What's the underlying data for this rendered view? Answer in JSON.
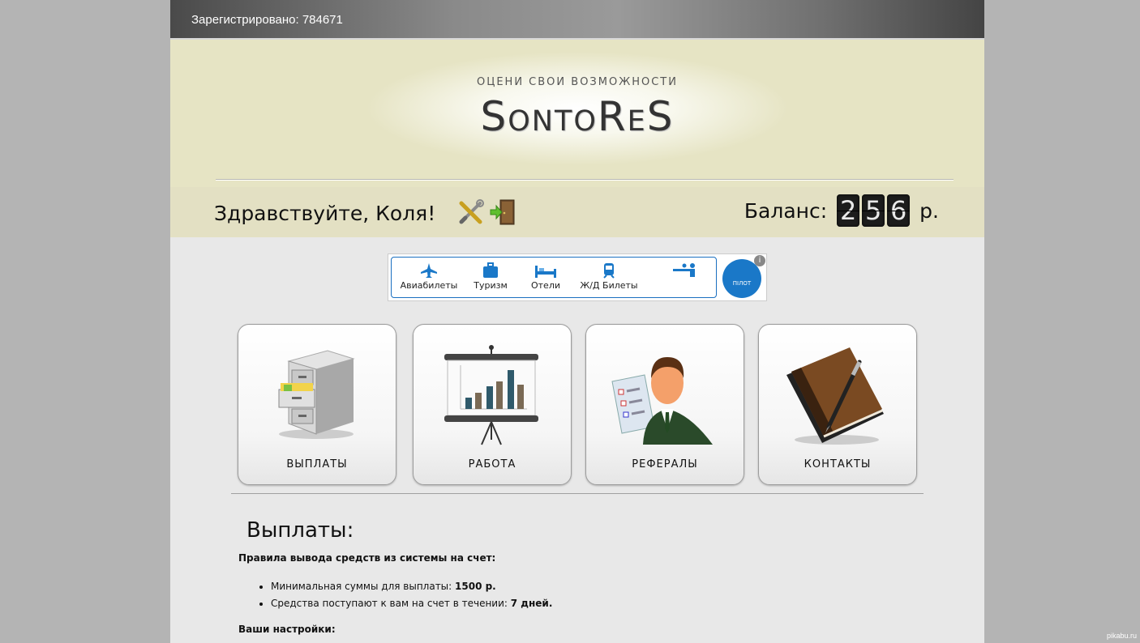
{
  "topbar": {
    "registered": "Зарегистрировано: 784671"
  },
  "header": {
    "slogan": "ОЦЕНИ СВОИ ВОЗМОЖНОСТИ",
    "logo": "SontoReS"
  },
  "user": {
    "greeting": "Здравствуйте, Коля!",
    "balance_label": "Баланс:",
    "balance_digits": [
      "2",
      "5",
      "6"
    ],
    "currency": "р."
  },
  "ad": {
    "items": [
      "Авиабилеты",
      "Туризм",
      "Отели",
      "Ж/Д Билеты"
    ],
    "brand": "ПІЛОТ",
    "info": "i"
  },
  "tiles": [
    "ВЫПЛАТЫ",
    "РАБОТА",
    "РЕФЕРАЛЫ",
    "КОНТАКТЫ"
  ],
  "content": {
    "title": "Выплаты:",
    "rules_title": "Правила вывода средств из системы на счет:",
    "rules": [
      {
        "text": "Минимальная суммы для выплаты: ",
        "value": "1500 р."
      },
      {
        "text": "Средства поступают к вам на счет в течении: ",
        "value": "7 дней."
      }
    ],
    "settings_title": "Ваши настройки:"
  },
  "watermark": "pikabu.ru"
}
